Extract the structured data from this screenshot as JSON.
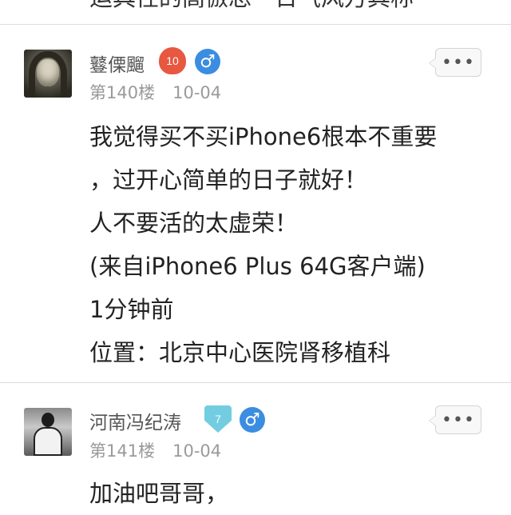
{
  "top_partial_text": "运具性的高倣总一日气风万其称",
  "posts": [
    {
      "username": "鼟傈飀",
      "level": "10",
      "gender_icon": "♂",
      "floor": "第140楼",
      "date": "10-04",
      "more_label": "•••",
      "content_lines": [
        "我觉得买不买iPhone6根本不重要",
        "，过开心简单的日子就好！",
        "人不要活的太虚荣！",
        "(来自iPhone6 Plus 64G客户端)",
        "1分钟前",
        "位置：北京中心医院肾移植科"
      ]
    },
    {
      "username": "河南冯纪涛",
      "level": "7",
      "gender_icon": "♂",
      "floor": "第141楼",
      "date": "10-04",
      "more_label": "•••",
      "content_lines": [
        "加油吧哥哥，"
      ]
    }
  ],
  "colors": {
    "level_badge_red": "#e8573f",
    "level_badge_cyan": "#72cde0",
    "gender_blue": "#3a8de0"
  }
}
